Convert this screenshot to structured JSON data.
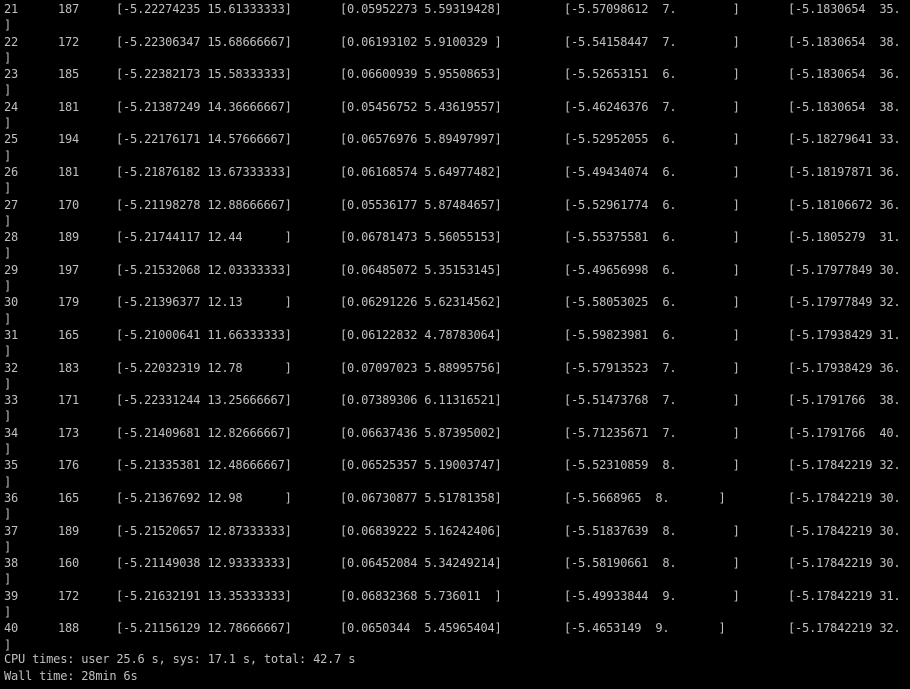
{
  "rows": [
    {
      "idx": "21",
      "n": "187",
      "a": "[-5.22274235 15.61333333]",
      "b": "[0.05952273 5.59319428]",
      "c": "[-5.57098612  7.        ]",
      "d": "[-5.1830654  35."
    },
    {
      "idx": "22",
      "n": "172",
      "a": "[-5.22306347 15.68666667]",
      "b": "[0.06193102 5.9100329 ]",
      "c": "[-5.54158447  7.        ]",
      "d": "[-5.1830654  38."
    },
    {
      "idx": "23",
      "n": "185",
      "a": "[-5.22382173 15.58333333]",
      "b": "[0.06600939 5.95508653]",
      "c": "[-5.52653151  6.        ]",
      "d": "[-5.1830654  36."
    },
    {
      "idx": "24",
      "n": "181",
      "a": "[-5.21387249 14.36666667]",
      "b": "[0.05456752 5.43619557]",
      "c": "[-5.46246376  7.        ]",
      "d": "[-5.1830654  38."
    },
    {
      "idx": "25",
      "n": "194",
      "a": "[-5.22176171 14.57666667]",
      "b": "[0.06576976 5.89497997]",
      "c": "[-5.52952055  6.        ]",
      "d": "[-5.18279641 33."
    },
    {
      "idx": "26",
      "n": "181",
      "a": "[-5.21876182 13.67333333]",
      "b": "[0.06168574 5.64977482]",
      "c": "[-5.49434074  6.        ]",
      "d": "[-5.18197871 36."
    },
    {
      "idx": "27",
      "n": "170",
      "a": "[-5.21198278 12.88666667]",
      "b": "[0.05536177 5.87484657]",
      "c": "[-5.52961774  6.        ]",
      "d": "[-5.18106672 36."
    },
    {
      "idx": "28",
      "n": "189",
      "a": "[-5.21744117 12.44      ]",
      "b": "[0.06781473 5.56055153]",
      "c": "[-5.55375581  6.        ]",
      "d": "[-5.1805279  31."
    },
    {
      "idx": "29",
      "n": "197",
      "a": "[-5.21532068 12.03333333]",
      "b": "[0.06485072 5.35153145]",
      "c": "[-5.49656998  6.        ]",
      "d": "[-5.17977849 30."
    },
    {
      "idx": "30",
      "n": "179",
      "a": "[-5.21396377 12.13      ]",
      "b": "[0.06291226 5.62314562]",
      "c": "[-5.58053025  6.        ]",
      "d": "[-5.17977849 32."
    },
    {
      "idx": "31",
      "n": "165",
      "a": "[-5.21000641 11.66333333]",
      "b": "[0.06122832 4.78783064]",
      "c": "[-5.59823981  6.        ]",
      "d": "[-5.17938429 31."
    },
    {
      "idx": "32",
      "n": "183",
      "a": "[-5.22032319 12.78      ]",
      "b": "[0.07097023 5.88995756]",
      "c": "[-5.57913523  7.        ]",
      "d": "[-5.17938429 36."
    },
    {
      "idx": "33",
      "n": "171",
      "a": "[-5.22331244 13.25666667]",
      "b": "[0.07389306 6.11316521]",
      "c": "[-5.51473768  7.        ]",
      "d": "[-5.1791766  38."
    },
    {
      "idx": "34",
      "n": "173",
      "a": "[-5.21409681 12.82666667]",
      "b": "[0.06637436 5.87395002]",
      "c": "[-5.71235671  7.        ]",
      "d": "[-5.1791766  40."
    },
    {
      "idx": "35",
      "n": "176",
      "a": "[-5.21335381 12.48666667]",
      "b": "[0.06525357 5.19003747]",
      "c": "[-5.52310859  8.        ]",
      "d": "[-5.17842219 32."
    },
    {
      "idx": "36",
      "n": "165",
      "a": "[-5.21367692 12.98      ]",
      "b": "[0.06730877 5.51781358]",
      "c": "[-5.5668965  8.       ]",
      "d": "[-5.17842219 30."
    },
    {
      "idx": "37",
      "n": "189",
      "a": "[-5.21520657 12.87333333]",
      "b": "[0.06839222 5.16242406]",
      "c": "[-5.51837639  8.        ]",
      "d": "[-5.17842219 30."
    },
    {
      "idx": "38",
      "n": "160",
      "a": "[-5.21149038 12.93333333]",
      "b": "[0.06452084 5.34249214]",
      "c": "[-5.58190661  8.        ]",
      "d": "[-5.17842219 30."
    },
    {
      "idx": "39",
      "n": "172",
      "a": "[-5.21632191 13.35333333]",
      "b": "[0.06832368 5.736011  ]",
      "c": "[-5.49933844  9.        ]",
      "d": "[-5.17842219 31."
    },
    {
      "idx": "40",
      "n": "188",
      "a": "[-5.21156129 12.78666667]",
      "b": "[0.0650344  5.45965404]",
      "c": "[-5.4653149  9.       ]",
      "d": "[-5.17842219 32."
    }
  ],
  "row_close": "]",
  "footer": {
    "cpu_times": "CPU times: user 25.6 s, sys: 17.1 s, total: 42.7 s",
    "wall_time": "Wall time: 28min 6s"
  }
}
